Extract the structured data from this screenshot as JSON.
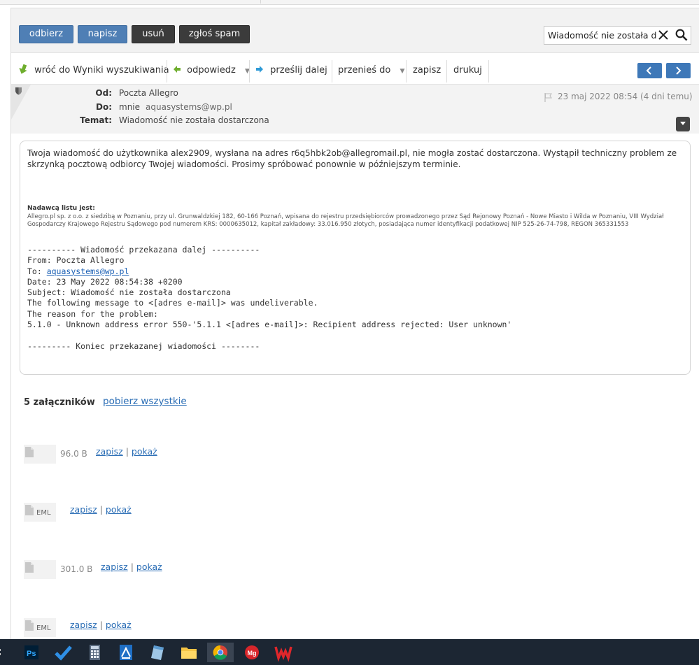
{
  "toolbar": {
    "receive": "odbierz",
    "compose": "napisz",
    "delete": "usuń",
    "spam": "zgłoś spam",
    "search_value": "Wiadomość nie została dostarczona"
  },
  "actions": {
    "back": "wróć do Wyniki wyszukiwania",
    "reply": "odpowiedz",
    "forward": "prześlij dalej",
    "move": "przenieś do",
    "save": "zapisz",
    "print": "drukuj"
  },
  "header": {
    "from_label": "Od:",
    "from_value": "Poczta Allegro",
    "to_label": "Do:",
    "to_name": "mnie",
    "to_email": "aquasystems@wp.pl",
    "subject_label": "Temat:",
    "subject_value": "Wiadomość nie została dostarczona",
    "date": "23 maj 2022 08:54 (4 dni temu)"
  },
  "body": {
    "paragraph": "Twoja wiadomość do użytkownika alex2909, wysłana na adres r6q5hbk2ob@allegromail.pl, nie mogła zostać dostarczona. Wystąpił techniczny problem ze skrzynką pocztową odbiorcy Twojej wiadomości. Prosimy spróbować ponownie w późniejszym terminie.",
    "sender_heading": "Nadawcą listu jest:",
    "legal": "Allegro.pl sp. z o.o. z siedzibą w Poznaniu, przy ul. Grunwaldzkiej 182, 60-166 Poznań, wpisana do rejestru przedsiębiorców prowadzonego przez Sąd Rejonowy Poznań - Nowe Miasto i Wilda w Poznaniu, VIII Wydział Gospodarczy Krajowego Rejestru Sądowego pod numerem KRS: 0000635012, kapitał zakładowy: 33.016.950 złotych, posiadająca numer identyfikacji podatkowej NIP 525-26-74-798, REGON 365331553",
    "fwd_start": "---------- Wiadomość przekazana dalej ----------",
    "fwd_from": "From: Poczta Allegro",
    "fwd_to_label": "To: ",
    "fwd_to_email": "aquasystems@wp.pl",
    "fwd_date": "Date: 23 May 2022 08:54:38 +0200",
    "fwd_subject": "Subject: Wiadomość nie została dostarczona",
    "fwd_line1": "The following message to <[adres e-mail]> was undeliverable.",
    "fwd_line2": "The reason for the problem:",
    "fwd_line3": "5.1.0 - Unknown address error 550-'5.1.1 <[adres e-mail]>: Recipient address rejected: User unknown'",
    "fwd_end": "--------- Koniec przekazanej wiadomości --------"
  },
  "attachments": {
    "heading": "5 załączników",
    "download_all": "pobierz wszystkie",
    "save": "zapisz",
    "show": "pokaż",
    "divider": "|",
    "items": [
      {
        "ext": "",
        "size": "96.0 B"
      },
      {
        "ext": "EML",
        "size": ""
      },
      {
        "ext": "",
        "size": "301.0 B"
      },
      {
        "ext": "EML",
        "size": ""
      }
    ]
  },
  "colors": {
    "primary_button": "#4f7fb5",
    "dark_button": "#3b3b3b",
    "link": "#2a6db5",
    "taskbar": "#1c2633"
  },
  "taskbar_icons": [
    "photoshop-icon",
    "checkmark-app-icon",
    "calculator-icon",
    "document-app-icon",
    "notepad-icon",
    "file-explorer-icon",
    "chrome-icon",
    "mg-app-icon",
    "wps-office-icon"
  ]
}
